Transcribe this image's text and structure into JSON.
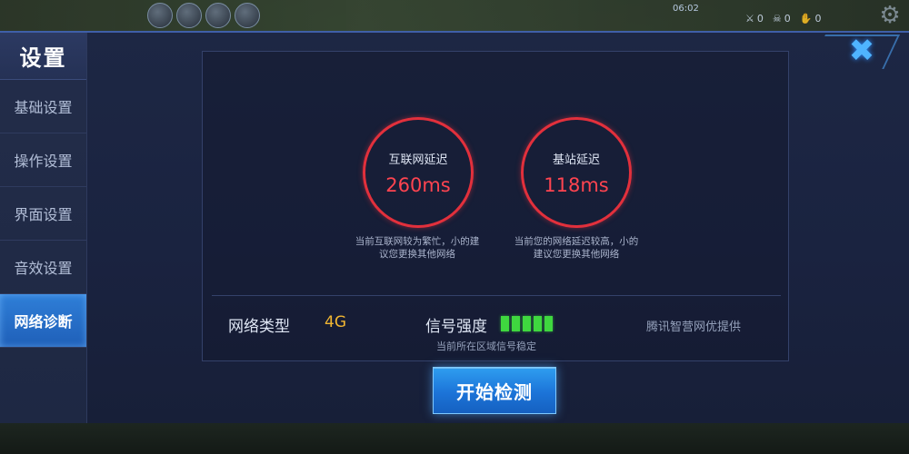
{
  "hud": {
    "time": "06:02",
    "stats": [
      "0",
      "0",
      "0"
    ]
  },
  "sidebar": {
    "title": "设置",
    "items": [
      {
        "label": "基础设置"
      },
      {
        "label": "操作设置"
      },
      {
        "label": "界面设置"
      },
      {
        "label": "音效设置"
      },
      {
        "label": "网络诊断"
      }
    ],
    "active_index": 4
  },
  "internet_latency": {
    "label": "互联网延迟",
    "value": "260ms",
    "note": "当前互联网较为繁忙，小的建议您更换其他网络"
  },
  "base_latency": {
    "label": "基站延迟",
    "value": "118ms",
    "note": "当前您的网络延迟较高，小的建议您更换其他网络"
  },
  "network": {
    "type_label": "网络类型",
    "type_value": "4G",
    "signal_label": "信号强度",
    "signal_bars": 5,
    "signal_note": "当前所在区域信号稳定",
    "provider": "腾讯智营网优提供"
  },
  "start_button": {
    "label": "开始检测"
  },
  "colors": {
    "accent": "#1c74d8",
    "latency_ring": "#e2303c",
    "signal": "#3fd73f",
    "type_value": "#f2b632"
  }
}
